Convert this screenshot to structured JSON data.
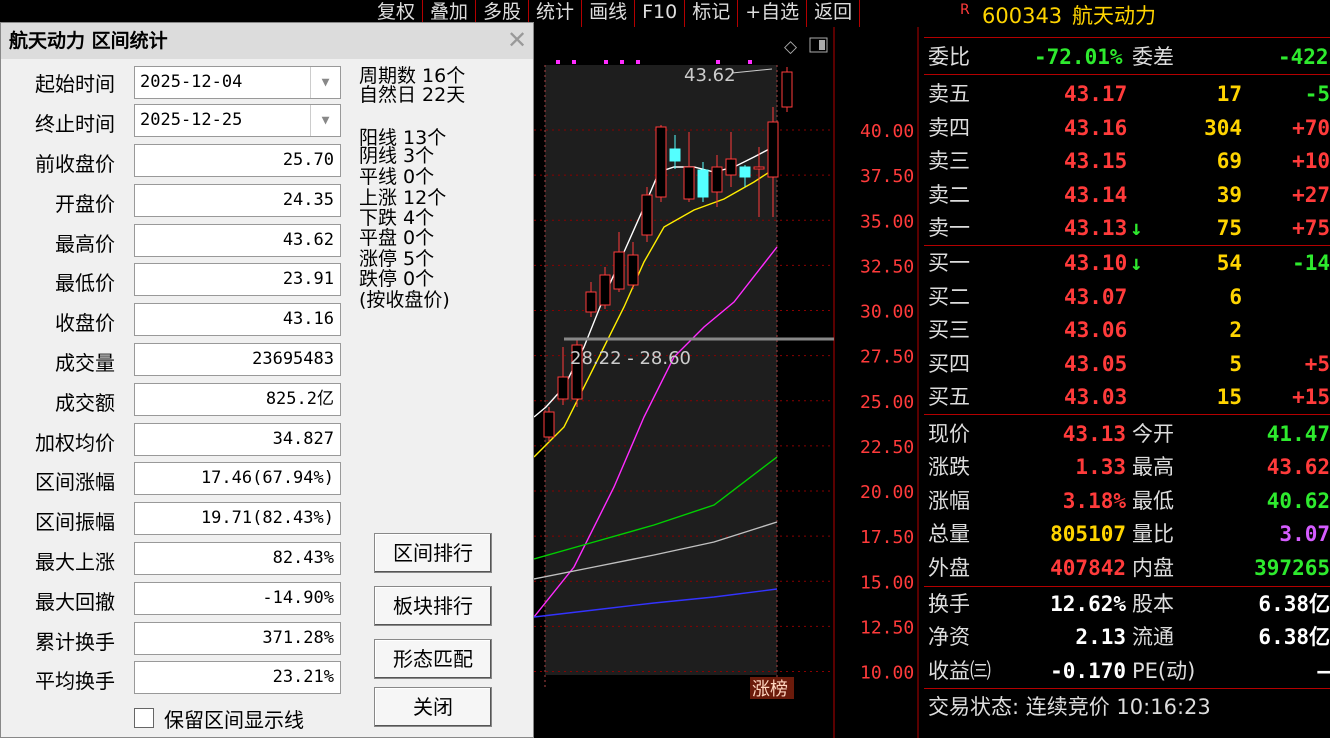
{
  "toolbar": [
    "复权",
    "叠加",
    "多股",
    "统计",
    "画线",
    "F10",
    "标记",
    "+自选",
    "返回"
  ],
  "chart": {
    "price_ticks": [
      "40.00",
      "37.50",
      "35.00",
      "32.50",
      "30.00",
      "27.50",
      "25.00",
      "22.50",
      "20.00",
      "17.50",
      "15.00",
      "12.50",
      "10.00"
    ],
    "high_annotation": "43.62",
    "range_label": "28.22 - 28.60",
    "tag": "涨榜",
    "colors": {
      "up": "#ff3b3b",
      "down": "#54ffff",
      "ma5": "#ffffff",
      "ma10": "#ffee00",
      "ma20": "#ff2bff",
      "ma60": "#00d000",
      "ma120": "#c0c0c0",
      "ma250": "#3333ff"
    }
  },
  "quote": {
    "code": "600343",
    "name": "航天动力",
    "r_flag": "R",
    "weibi_label": "委比",
    "weibi": "-72.01%",
    "weicha_label": "委差",
    "weicha": "-422",
    "asks": [
      {
        "label": "卖五",
        "price": "43.17",
        "vol": "17",
        "chg": "-5",
        "arrow": ""
      },
      {
        "label": "卖四",
        "price": "43.16",
        "vol": "304",
        "chg": "+70",
        "arrow": ""
      },
      {
        "label": "卖三",
        "price": "43.15",
        "vol": "69",
        "chg": "+10",
        "arrow": ""
      },
      {
        "label": "卖二",
        "price": "43.14",
        "vol": "39",
        "chg": "+27",
        "arrow": ""
      },
      {
        "label": "卖一",
        "price": "43.13",
        "vol": "75",
        "chg": "+75",
        "arrow": "↓"
      }
    ],
    "bids": [
      {
        "label": "买一",
        "price": "43.10",
        "vol": "54",
        "chg": "-14",
        "arrow": "↓"
      },
      {
        "label": "买二",
        "price": "43.07",
        "vol": "6",
        "chg": "",
        "arrow": ""
      },
      {
        "label": "买三",
        "price": "43.06",
        "vol": "2",
        "chg": "",
        "arrow": ""
      },
      {
        "label": "买四",
        "price": "43.05",
        "vol": "5",
        "chg": "+5",
        "arrow": ""
      },
      {
        "label": "买五",
        "price": "43.03",
        "vol": "15",
        "chg": "+15",
        "arrow": ""
      }
    ],
    "stats": [
      {
        "l1": "现价",
        "v1": "43.13",
        "c1": "red",
        "l2": "今开",
        "v2": "41.47",
        "c2": "grn"
      },
      {
        "l1": "涨跌",
        "v1": "1.33",
        "c1": "red",
        "l2": "最高",
        "v2": "43.62",
        "c2": "red"
      },
      {
        "l1": "涨幅",
        "v1": "3.18%",
        "c1": "red",
        "l2": "最低",
        "v2": "40.62",
        "c2": "grn"
      },
      {
        "l1": "总量",
        "v1": "805107",
        "c1": "yel",
        "l2": "量比",
        "v2": "3.07",
        "c2": "mag"
      },
      {
        "l1": "外盘",
        "v1": "407842",
        "c1": "red",
        "l2": "内盘",
        "v2": "397265",
        "c2": "grn"
      }
    ],
    "stats2": [
      {
        "l1": "换手",
        "v1": "12.62%",
        "l2": "股本",
        "v2": "6.38亿"
      },
      {
        "l1": "净资",
        "v1": "2.13",
        "l2": "流通",
        "v2": "6.38亿"
      },
      {
        "l1": "收益㈢",
        "v1": "-0.170",
        "l2": "PE(动)",
        "v2": "–"
      }
    ],
    "status": "交易状态: 连续竞价 10:16:23"
  },
  "dialog": {
    "title": "航天动力 区间统计",
    "start_label": "起始时间",
    "start": "2025-12-04",
    "end_label": "终止时间",
    "end": "2025-12-25",
    "fields": [
      {
        "label": "前收盘价",
        "value": "25.70"
      },
      {
        "label": "开盘价",
        "value": "24.35"
      },
      {
        "label": "最高价",
        "value": "43.62"
      },
      {
        "label": "最低价",
        "value": "23.91"
      },
      {
        "label": "收盘价",
        "value": "43.16"
      },
      {
        "label": "成交量",
        "value": "23695483"
      },
      {
        "label": "成交额",
        "value": "825.2亿"
      },
      {
        "label": "加权均价",
        "value": "34.827"
      },
      {
        "label": "区间涨幅",
        "value": "17.46(67.94%)"
      },
      {
        "label": "区间振幅",
        "value": "19.71(82.43%)"
      },
      {
        "label": "最大上涨",
        "value": "82.43%"
      },
      {
        "label": "最大回撤",
        "value": "-14.90%"
      },
      {
        "label": "累计换手",
        "value": "371.28%"
      },
      {
        "label": "平均换手",
        "value": "23.21%"
      }
    ],
    "info": [
      "周期数 16个",
      "自然日 22天",
      "",
      "阳线 13个",
      "阴线 3个",
      "平线 0个",
      "上涨 12个",
      "下跌 4个",
      "平盘 0个",
      "涨停 5个",
      "跌停 0个",
      "(按收盘价)"
    ],
    "buttons": [
      "区间排行",
      "板块排行",
      "形态匹配",
      "关闭"
    ],
    "keep_label": "保留区间显示线"
  }
}
